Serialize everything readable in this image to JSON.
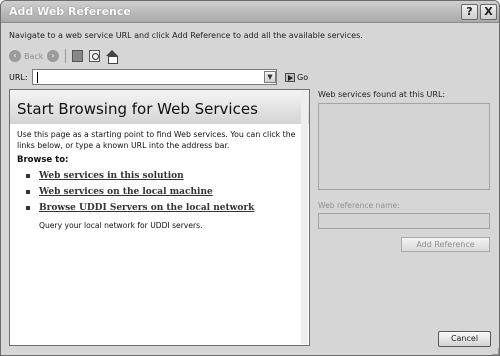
{
  "window": {
    "title": "Add Web Reference",
    "help_glyph": "?",
    "close_glyph": "X"
  },
  "instructions": "Navigate to a web service URL and click Add Reference to add all the available services.",
  "toolbar": {
    "back_label": "Back",
    "back_icon": "back-arrow-icon",
    "forward_icon": "forward-arrow-icon",
    "stop_icon": "stop-icon",
    "refresh_icon": "refresh-icon",
    "home_icon": "home-icon"
  },
  "url": {
    "label": "URL:",
    "value": "",
    "go_label": "Go"
  },
  "browser": {
    "heading": "Start Browsing for Web Services",
    "intro": "Use this page as a starting point to find Web services. You can click the links below, or type a known URL into the address bar.",
    "browse_to": "Browse to:",
    "links": [
      "Web services in this solution",
      "Web services on the local machine",
      "Browse UDDI Servers on the local network"
    ],
    "uddi_description": "Query your local network for UDDI servers."
  },
  "right_panel": {
    "services_found_label": "Web services found at this URL:",
    "reference_name_label": "Web reference name:",
    "reference_name_value": "",
    "add_reference_label": "Add Reference"
  },
  "footer": {
    "cancel_label": "Cancel"
  },
  "colors": {
    "dialog_background": "#d6d6d6",
    "title_text": "#ffffff",
    "disabled_text": "#8f8f8f"
  }
}
